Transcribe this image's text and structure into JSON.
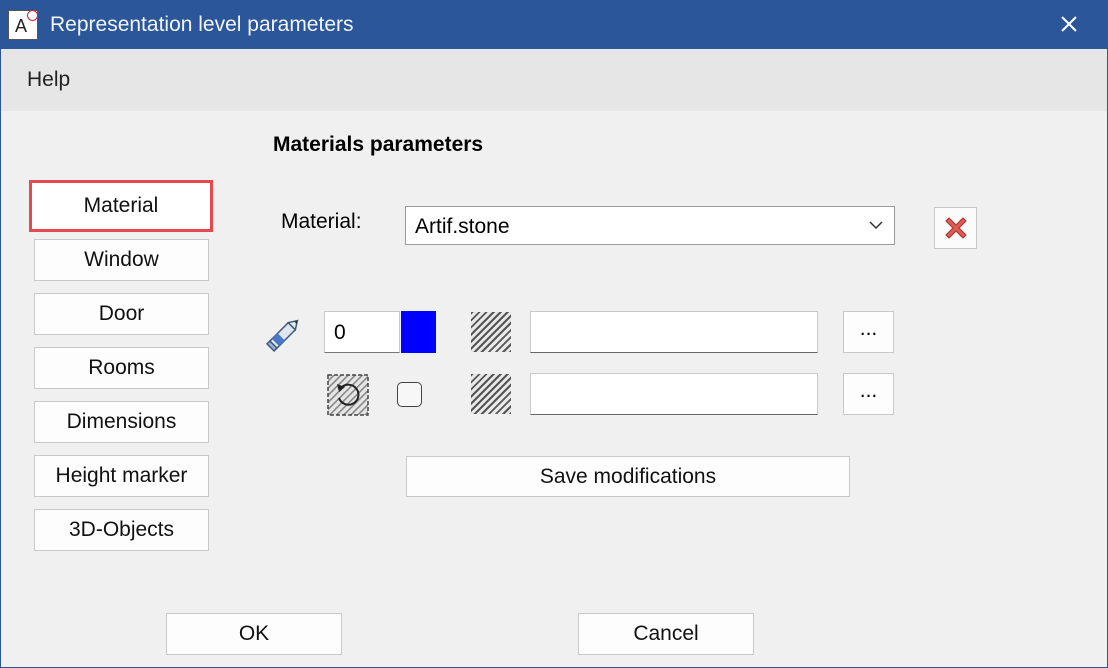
{
  "window": {
    "title": "Representation level parameters",
    "app_icon_letter": "A",
    "close_glyph": "✕"
  },
  "menu": {
    "help": "Help"
  },
  "section": {
    "title": "Materials parameters"
  },
  "categories": [
    {
      "label": "Material",
      "active": true
    },
    {
      "label": "Window"
    },
    {
      "label": "Door"
    },
    {
      "label": "Rooms"
    },
    {
      "label": "Dimensions"
    },
    {
      "label": "Height marker"
    },
    {
      "label": "3D-Objects"
    }
  ],
  "material": {
    "label": "Material:",
    "selected": "Artif.stone",
    "delete_icon": "red-x-icon"
  },
  "pen_row": {
    "pen_value": "0",
    "color": "#0000ff",
    "pattern_name": "",
    "browse_label": "..."
  },
  "rotate_row": {
    "checked": false,
    "pattern_name": "",
    "browse_label": "..."
  },
  "actions": {
    "save": "Save modifications",
    "ok": "OK",
    "cancel": "Cancel"
  },
  "colors": {
    "titlebar": "#2b579a",
    "active_border": "#e8494e",
    "delete_red": "#e05a55"
  }
}
